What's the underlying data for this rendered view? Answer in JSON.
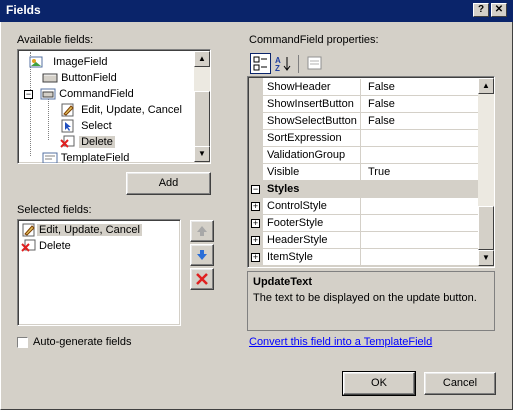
{
  "window": {
    "title": "Fields",
    "help_label": "?",
    "close_label": "✕"
  },
  "available": {
    "label": "Available fields:",
    "items": [
      {
        "label": "ImageField",
        "icon": "image-field-icon"
      },
      {
        "label": "ButtonField",
        "icon": "button-field-icon"
      },
      {
        "label": "CommandField",
        "icon": "command-field-icon",
        "expander": "−"
      },
      {
        "label": "Edit, Update, Cancel",
        "icon": "edit-command-icon"
      },
      {
        "label": "Select",
        "icon": "select-command-icon"
      },
      {
        "label": "Delete",
        "icon": "delete-command-icon",
        "selected": true
      },
      {
        "label": "TemplateField",
        "icon": "template-field-icon"
      }
    ],
    "add_label": "Add"
  },
  "selected": {
    "label": "Selected fields:",
    "items": [
      {
        "label": "Edit, Update, Cancel",
        "icon": "edit-command-icon",
        "selected": true
      },
      {
        "label": "Delete",
        "icon": "delete-command-icon"
      }
    ]
  },
  "autogen": {
    "label": "Auto-generate fields",
    "checked": false
  },
  "properties": {
    "label": "CommandField properties:",
    "rows": [
      {
        "name": "ShowHeader",
        "value": "False"
      },
      {
        "name": "ShowInsertButton",
        "value": "False"
      },
      {
        "name": "ShowSelectButton",
        "value": "False"
      },
      {
        "name": "SortExpression",
        "value": ""
      },
      {
        "name": "ValidationGroup",
        "value": ""
      },
      {
        "name": "Visible",
        "value": "True"
      },
      {
        "name": "Styles",
        "value": "",
        "category": true,
        "expander": "−"
      },
      {
        "name": "ControlStyle",
        "value": "",
        "expander": "+"
      },
      {
        "name": "FooterStyle",
        "value": "",
        "expander": "+"
      },
      {
        "name": "HeaderStyle",
        "value": "",
        "expander": "+"
      },
      {
        "name": "ItemStyle",
        "value": "",
        "expander": "+"
      }
    ],
    "desc_title": "UpdateText",
    "desc_text": "The text to be displayed on the update button.",
    "convert_link": "Convert this field into a TemplateField"
  },
  "buttons": {
    "ok": "OK",
    "cancel": "Cancel"
  },
  "colors": {
    "titlebar": "#0a246a",
    "face": "#d4d0c8",
    "link": "#0000ff"
  }
}
